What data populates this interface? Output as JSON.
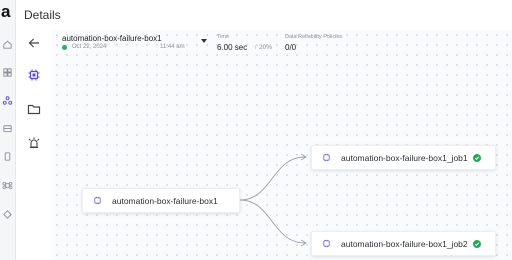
{
  "app": {
    "logo": "a"
  },
  "header": {
    "title": "Details"
  },
  "rail": {
    "items": [
      {
        "icon": "home-icon"
      },
      {
        "icon": "dashboard-icon"
      },
      {
        "icon": "pipelines-icon"
      },
      {
        "icon": "data-icon"
      },
      {
        "icon": "device-icon"
      },
      {
        "icon": "command-icon"
      },
      {
        "icon": "diamond-icon"
      }
    ]
  },
  "subnav": {
    "items": [
      {
        "icon": "back-arrow-icon"
      },
      {
        "icon": "chip-icon",
        "active": true
      },
      {
        "icon": "folder-icon"
      },
      {
        "icon": "alarm-icon"
      }
    ]
  },
  "job": {
    "name": "automation-box-failure-box1",
    "date": "Oct 22, 2024",
    "time": "11:44 am",
    "status_color": "#27ae60"
  },
  "metrics": {
    "time_label": "Time",
    "time_value": "6.00 sec",
    "time_delta": "↑ 20%",
    "policies_label": "Data Reliability Policies",
    "policies_value": "0/0"
  },
  "graph": {
    "root": {
      "label": "automation-box-failure-box1"
    },
    "children": [
      {
        "label": "automation-box-failure-box1_job1",
        "status": "success"
      },
      {
        "label": "automation-box-failure-box1_job2",
        "status": "success"
      }
    ]
  },
  "colors": {
    "success": "#2aa65c",
    "edge": "#9aa0aa",
    "accent": "#5b4bd6"
  }
}
